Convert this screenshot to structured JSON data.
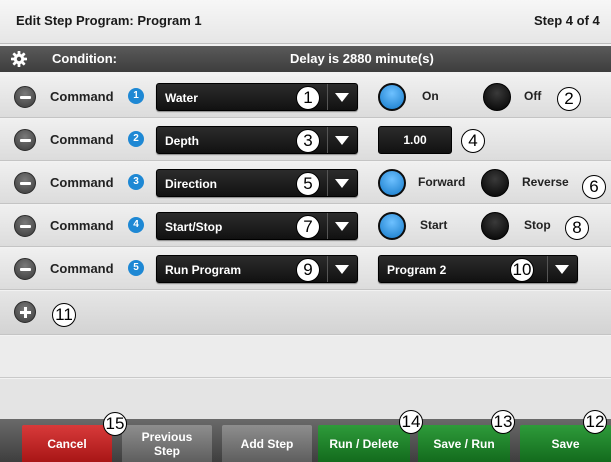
{
  "title": {
    "left": "Edit Step Program:  Program 1",
    "right": "Step 4 of 4"
  },
  "condition": {
    "label": "Condition:",
    "value": "Delay is 2880 minute(s)",
    "icon": "gear-icon"
  },
  "commands": [
    {
      "label": "Command",
      "num": "1",
      "select": "Water",
      "callout": "1",
      "radio_on_label": "On",
      "radio_off_label": "Off",
      "radio_callout": "2",
      "selected": "On"
    },
    {
      "label": "Command",
      "num": "2",
      "select": "Depth",
      "callout": "3",
      "value": "1.00",
      "value_callout": "4"
    },
    {
      "label": "Command",
      "num": "3",
      "select": "Direction",
      "callout": "5",
      "radio_on_label": "Forward",
      "radio_off_label": "Reverse",
      "radio_callout": "6",
      "selected": "Forward"
    },
    {
      "label": "Command",
      "num": "4",
      "select": "Start/Stop",
      "callout": "7",
      "radio_on_label": "Start",
      "radio_off_label": "Stop",
      "radio_callout": "8",
      "selected": "Start"
    },
    {
      "label": "Command",
      "num": "5",
      "select": "Run Program",
      "callout": "9",
      "program_select": "Program 2",
      "program_callout": "10"
    }
  ],
  "add_callout": "11",
  "footer": {
    "cancel": "Cancel",
    "previous_step_line1": "Previous",
    "previous_step_line2": "Step",
    "add_step": "Add Step",
    "run_delete": "Run / Delete",
    "save_run": "Save / Run",
    "save": "Save",
    "callout_cancel": "15",
    "callout_run_delete": "14",
    "callout_save_run": "13",
    "callout_save": "12"
  },
  "colors": {
    "accent_blue": "#1e88d4",
    "cancel_red": "#c02828",
    "save_green": "#1f8a2c",
    "gray_button": "#777777",
    "condition_bar": "#4a4a4a"
  }
}
